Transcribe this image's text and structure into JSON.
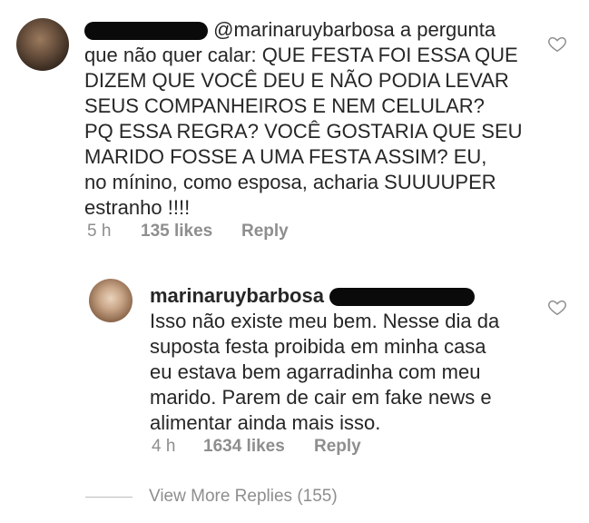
{
  "comment1": {
    "mention": "@marinaruybarbosa",
    "text_inline": " a pergunta",
    "lines": [
      "que não quer calar: QUE FESTA FOI ESSA QUE",
      "DIZEM QUE VOCÊ DEU E NÃO PODIA LEVAR",
      "SEUS COMPANHEIROS E NEM CELULAR?",
      "PQ ESSA REGRA? VOCÊ GOSTARIA QUE SEU",
      "MARIDO FOSSE A UMA FESTA ASSIM? EU,",
      "no mínino, como esposa, acharia SUUUUPER",
      "estranho !!!!"
    ],
    "time": "5 h",
    "likes": "135 likes",
    "reply": "Reply"
  },
  "comment2": {
    "username": "marinaruybarbosa",
    "lines": [
      "Isso não existe meu bem. Nesse dia da",
      "suposta festa proibida em minha casa",
      "eu estava bem agarradinha com meu",
      "marido. Parem de cair em fake news e",
      "alimentar ainda mais isso."
    ],
    "time": "4 h",
    "likes": "1634 likes",
    "reply": "Reply"
  },
  "view_more": "View More Replies (155)",
  "icons": {
    "like": "heart-outline-icon"
  },
  "colors": {
    "text": "#262626",
    "meta": "#8e8e8e",
    "background": "#ffffff"
  }
}
